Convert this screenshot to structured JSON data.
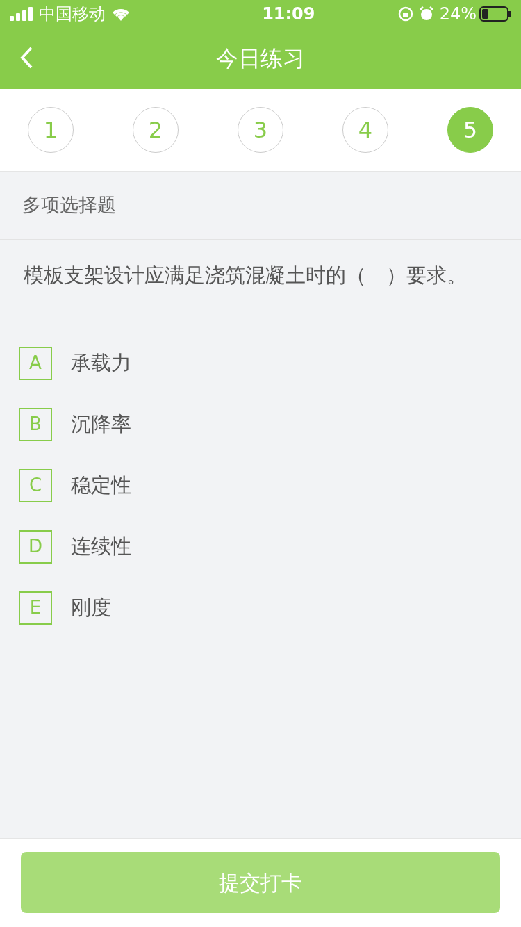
{
  "status_bar": {
    "carrier": "中国移动",
    "time": "11:09",
    "battery": "24%"
  },
  "nav": {
    "title": "今日练习"
  },
  "steps": [
    {
      "label": "1",
      "selected": false
    },
    {
      "label": "2",
      "selected": false
    },
    {
      "label": "3",
      "selected": false
    },
    {
      "label": "4",
      "selected": false
    },
    {
      "label": "5",
      "selected": true
    }
  ],
  "question": {
    "type": "多项选择题",
    "text": "模板支架设计应满足浇筑混凝土时的（　）要求。",
    "options": [
      {
        "letter": "A",
        "text": "承载力",
        "selected": false
      },
      {
        "letter": "B",
        "text": "沉降率",
        "selected": false
      },
      {
        "letter": "C",
        "text": "稳定性",
        "selected": false
      },
      {
        "letter": "D",
        "text": "连续性",
        "selected": false
      },
      {
        "letter": "E",
        "text": "刚度",
        "selected": false
      }
    ]
  },
  "submit": {
    "label": "提交打卡",
    "disabled": true
  }
}
